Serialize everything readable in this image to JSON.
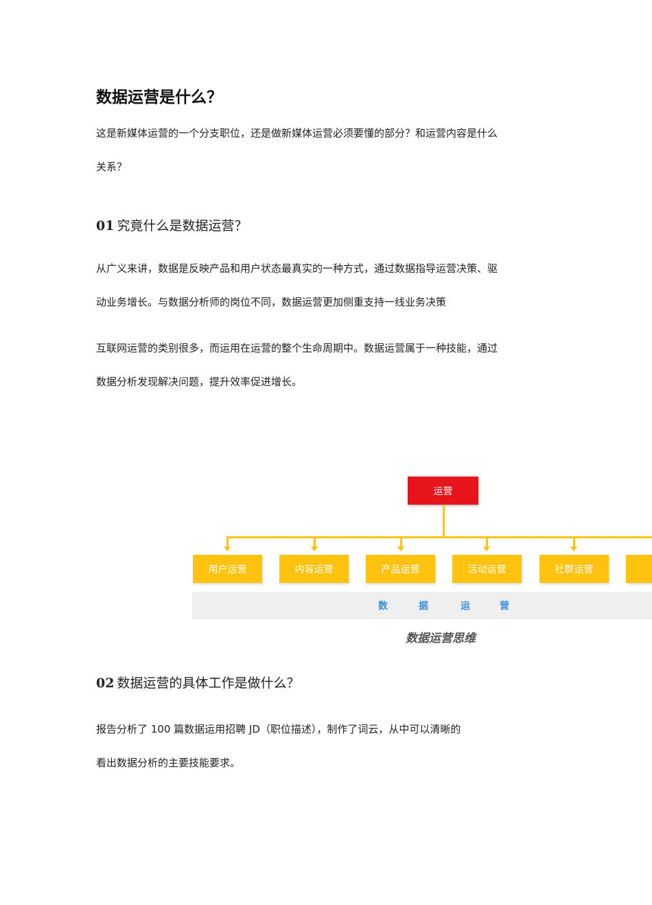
{
  "title": "数据运营是什么？",
  "intro": [
    "这是新媒体运营的一个分支职位，还是做新媒体运营必须要懂的部分？和运营内容是什么",
    "关系？"
  ],
  "section1": {
    "num": "01",
    "heading": "究竟什么是数据运营？",
    "para1": [
      "从广义来讲，数据是反映产品和用户状态最真实的一种方式，通过数据指导运营决策、驱",
      "动业务增长。与数据分析师的岗位不同，数据运营更加侧重支持一线业务决策"
    ],
    "para2": [
      "互联网运营的类别很多，而运用在运营的整个生命周期中。数据运营属于一种技能，通过",
      "数据分析发现解决问题，提升效率促进增长。"
    ]
  },
  "diagram": {
    "root": "运营",
    "children": [
      "用户运营",
      "内容运营",
      "产品运营",
      "活动运营",
      "社群运营",
      ""
    ],
    "base_chars": [
      "数",
      "据",
      "运",
      "营"
    ],
    "caption": "数据运营思维",
    "colors": {
      "root": "#e8141b",
      "child": "#ffc20e",
      "base_text": "#3a8fd6",
      "base_bg": "#efefef"
    }
  },
  "section2": {
    "num": "02",
    "heading": "数据运营的具体工作是做什么？",
    "para": [
      "报告分析了 100 篇数据运用招聘 JD（职位描述），制作了词云，从中可以清晰的",
      "看出数据分析的主要技能要求。"
    ]
  }
}
